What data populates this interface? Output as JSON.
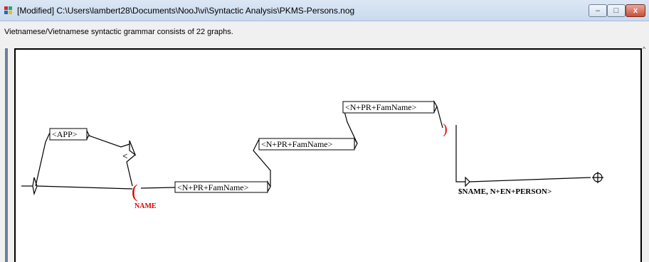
{
  "window": {
    "title": "[Modified] C:\\Users\\lambert28\\Documents\\NooJ\\vi\\Syntactic Analysis\\PKMS-Persons.nog",
    "buttons": {
      "minimize": "–",
      "maximize": "□",
      "close": "x"
    }
  },
  "status": {
    "text": "Vietnamese/Vietnamese syntactic grammar consists of 22 graphs."
  },
  "graph": {
    "nodes": {
      "app": "<APP>",
      "lt": "<",
      "open_paren": "(",
      "name_var": "NAME",
      "famname1": "<N+PR+FamName>",
      "famname2": "<N+PR+FamName>",
      "famname3": "<N+PR+FamName>",
      "close_paren": ")",
      "output": "$NAME, N+EN+PERSON>"
    },
    "colors": {
      "variable": "#e00000",
      "line": "#000000"
    }
  }
}
